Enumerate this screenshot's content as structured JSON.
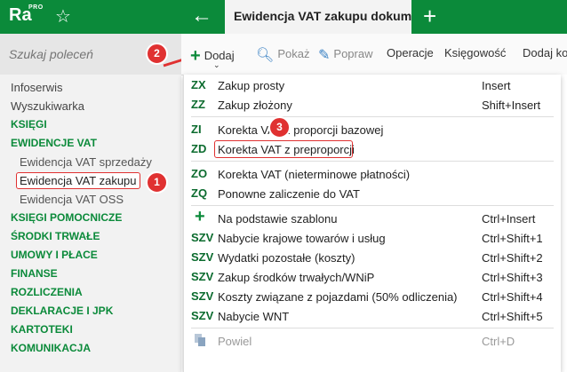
{
  "app": {
    "logo": "Ra",
    "logo_sup": "PRO"
  },
  "tab": {
    "title": "Ewidencja VAT zakupu dokumenty"
  },
  "sidebar": {
    "search_placeholder": "Szukaj poleceń",
    "items": [
      {
        "label": "Infoserwis",
        "type": "plain"
      },
      {
        "label": "Wyszukiwarka",
        "type": "plain"
      },
      {
        "label": "KSIĘGI",
        "type": "section"
      },
      {
        "label": "EWIDENCJE VAT",
        "type": "section"
      },
      {
        "label": "Ewidencja VAT sprzedaży",
        "type": "sub"
      },
      {
        "label": "Ewidencja VAT zakupu",
        "type": "sub-active"
      },
      {
        "label": "Ewidencja VAT OSS",
        "type": "sub"
      },
      {
        "label": "KSIĘGI POMOCNICZE",
        "type": "section"
      },
      {
        "label": "ŚRODKI TRWAŁE",
        "type": "section"
      },
      {
        "label": "UMOWY I PŁACE",
        "type": "section"
      },
      {
        "label": "FINANSE",
        "type": "section"
      },
      {
        "label": "ROZLICZENIA",
        "type": "section"
      },
      {
        "label": "DEKLARACJE I JPK",
        "type": "section"
      },
      {
        "label": "KARTOTEKI",
        "type": "section"
      },
      {
        "label": "KOMUNIKACJA",
        "type": "section"
      }
    ]
  },
  "toolbar": {
    "dodaj": "Dodaj",
    "pokaz": "Pokaż",
    "popraw": "Popraw",
    "operacje": "Operacje",
    "ksiegowosc": "Księgowość",
    "dodaj_kolejny": "Dodaj kolejny"
  },
  "badges": {
    "one": "1",
    "two": "2",
    "three": "3"
  },
  "menu": [
    {
      "code": "ZX",
      "label": "Zakup prosty",
      "shortcut": "Insert"
    },
    {
      "code": "ZZ",
      "label": "Zakup złożony",
      "shortcut": "Shift+Insert"
    },
    {
      "code": "ZI",
      "label": "Korekta VAT z proporcji bazowej",
      "shortcut": ""
    },
    {
      "code": "ZD",
      "label": "Korekta VAT z preproporcji",
      "shortcut": ""
    },
    {
      "code": "ZO",
      "label": "Korekta VAT (nieterminowe płatności)",
      "shortcut": ""
    },
    {
      "code": "ZQ",
      "label": "Ponowne zaliczenie do VAT",
      "shortcut": ""
    },
    {
      "code": "+",
      "label": "Na podstawie szablonu",
      "shortcut": "Ctrl+Insert"
    },
    {
      "code": "SZV",
      "label": "Nabycie krajowe towarów i usług",
      "shortcut": "Ctrl+Shift+1"
    },
    {
      "code": "SZV",
      "label": "Wydatki pozostałe (koszty)",
      "shortcut": "Ctrl+Shift+2"
    },
    {
      "code": "SZV",
      "label": "Zakup środków trwałych/WNiP",
      "shortcut": "Ctrl+Shift+3"
    },
    {
      "code": "SZV",
      "label": "Koszty związane z pojazdami (50% odliczenia)",
      "shortcut": "Ctrl+Shift+4"
    },
    {
      "code": "SZV",
      "label": "Nabycie WNT",
      "shortcut": "Ctrl+Shift+5"
    },
    {
      "code": "",
      "label": "Powiel",
      "shortcut": "Ctrl+D"
    }
  ],
  "colors": {
    "brand_green": "#0b8a3a",
    "code_green": "#0b6b2e",
    "annotation_red": "#e03131"
  }
}
